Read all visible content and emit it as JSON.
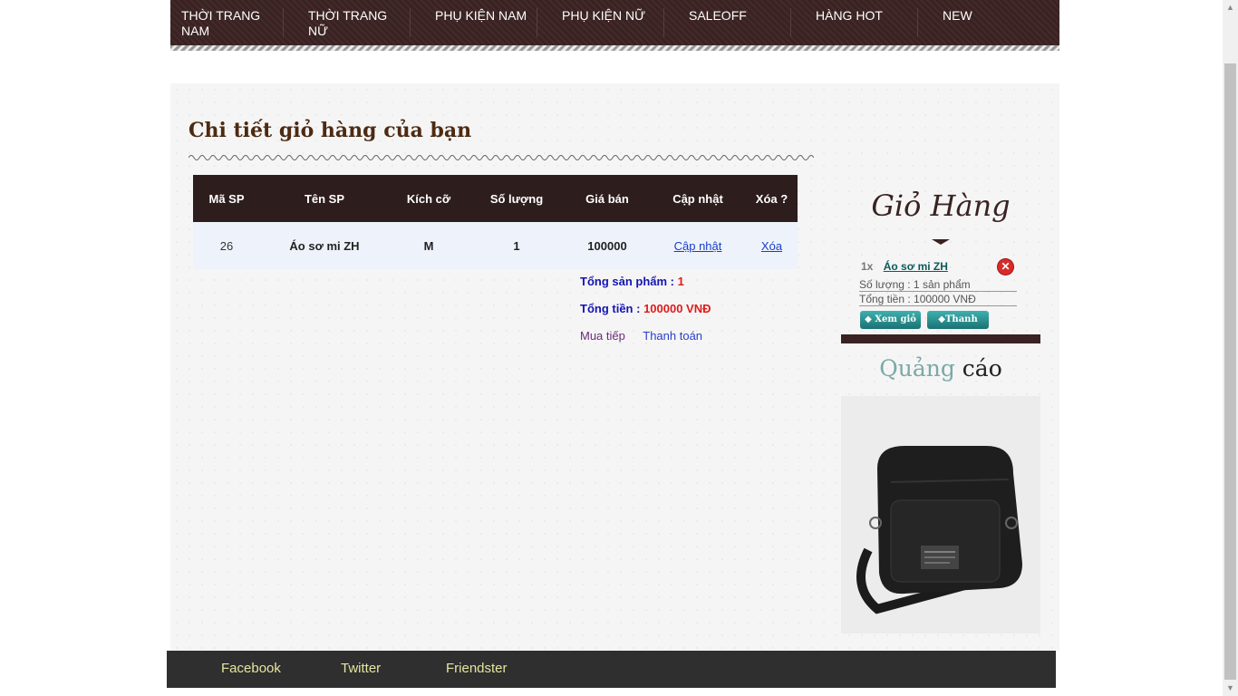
{
  "nav": [
    {
      "label": "THỜI TRANG NAM"
    },
    {
      "label": "THỜI TRANG NỮ"
    },
    {
      "label": "PHỤ KIỆN NAM"
    },
    {
      "label": "PHỤ KIỆN NỮ"
    },
    {
      "label": "SALEOFF"
    },
    {
      "label": "HÀNG HOT"
    },
    {
      "label": "NEW"
    }
  ],
  "page": {
    "title": "Chi tiết giỏ hàng của bạn"
  },
  "table": {
    "headers": [
      "Mã SP",
      "Tên SP",
      "Kích cỡ",
      "Số lượng",
      "Giá bán",
      "Cập nhật",
      "Xóa ?"
    ],
    "rows": [
      {
        "id": "26",
        "name": "Áo sơ mi ZH",
        "size": "M",
        "qty": "1",
        "price": "100000",
        "update": "Cập nhật",
        "delete": "Xóa"
      }
    ]
  },
  "summary": {
    "total_products_label": "Tổng sản phẩm :",
    "total_products_value": "1",
    "total_price_label": "Tổng tiền :",
    "total_price_value": "100000 VNĐ",
    "continue_label": "Mua tiếp",
    "checkout_label": "Thanh toán"
  },
  "sidebar": {
    "cart_title": "Giỏ Hàng",
    "item_qty": "1x",
    "item_name": "Áo sơ mi ZH",
    "qty_line": "Số lượng : 1 sản phẩm",
    "total_line": "Tổng tiền : 100000 VNĐ",
    "view_cart_label": "Xem giỏ",
    "checkout_label": "Thanh toán",
    "ad_title_part1": "Quảng",
    "ad_title_part2": "cáo"
  },
  "footer": {
    "links": [
      "Facebook",
      "Twitter",
      "Friendster"
    ]
  },
  "colors": {
    "nav_bg": "#3a2222",
    "link_blue": "#1a3dc9",
    "price_red": "#e01a1a",
    "accent_teal": "#1a7272"
  }
}
